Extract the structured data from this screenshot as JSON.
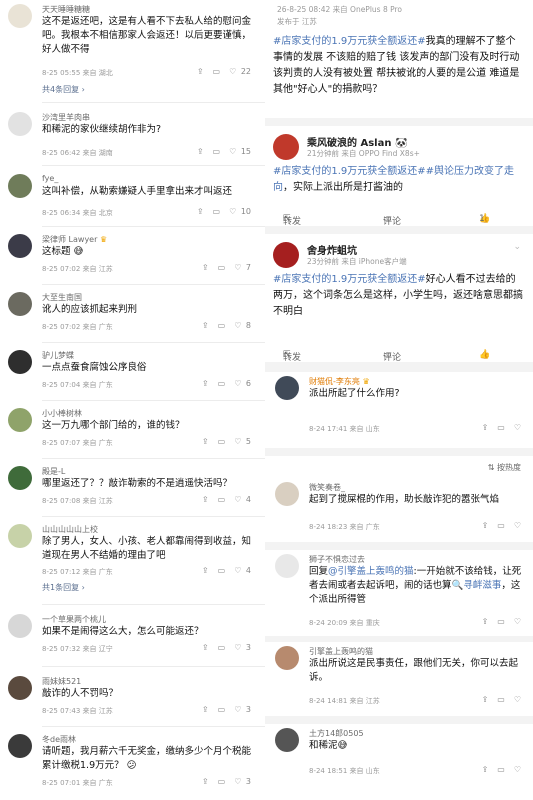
{
  "left": [
    {
      "name": "天天睡睡糖糖",
      "text": "这不是返还吧，这是有人看不下去私人给的慰问金吧。我根本不相信那家人会返还！以后更要谨慎，好人做不得",
      "meta": "8-25 05:55 来自 湖北",
      "likes": "22",
      "replies": "共4条回复"
    },
    {
      "name": "沙湾里羊肉串",
      "text": "和稀泥的家伙继续胡作非为?",
      "meta": "8-25 06:42 来自 湖南",
      "likes": "15"
    },
    {
      "name": "fye_",
      "text": "这叫补偿，从勒索嫌疑人手里拿出来才叫返还",
      "meta": "8-25 06:34 来自 北京",
      "likes": "10"
    },
    {
      "name": "梁律师 Lawyer",
      "text": "这标题",
      "meta": "8-25 07:02 来自 江苏",
      "likes": "7"
    },
    {
      "name": "大至生南国",
      "text": "讹人的应该抓起来判刑",
      "meta": "8-25 07:02 来自 广东",
      "likes": "8"
    },
    {
      "name": "驴儿梦蝶",
      "text": "一点点蚕食腐蚀公序良俗",
      "meta": "8-25 07:04 来自 广东",
      "likes": "6"
    },
    {
      "name": "小小棒树林",
      "text": "这一万九哪个部门给的，谁的钱？",
      "meta": "8-25 07:07 来自 广东",
      "likes": "5"
    },
    {
      "name": "殿是-L",
      "text": "哪里返还了？？敲诈勒索的不是逍遥快活吗？",
      "meta": "8-25 07:08 来自 江苏",
      "likes": "4"
    },
    {
      "name": "山山山山山上校",
      "text": "除了男人，女人、小孩、老人都靠闹得到收益，知道现在男人不结婚的理由了吧",
      "meta": "8-25 07:12 来自 广东",
      "likes": "4",
      "replies": "共1条回复"
    },
    {
      "name": "一个草果两个桃儿",
      "text": "如果不是闹得这么大，怎么可能返还？",
      "meta": "8-25 07:32 来自 辽宁",
      "likes": "3"
    },
    {
      "name": "雨妹妹521",
      "text": "敲诈的人不罚吗？",
      "meta": "8-25 07:43 来自 江苏",
      "likes": "3"
    },
    {
      "name": "冬de雨林",
      "text": "请听题，我月薪六千无奖金，缴纳多少个月个税能累计缴税1.9万元？",
      "meta": "8-25 07:01 来自 广东",
      "likes": "3"
    }
  ],
  "right": {
    "top_meta1": "26-8-25 08:42  来自 OnePlus 8 Pro",
    "top_meta2": "发布于 江苏",
    "post1_text_tag": "#店家支付的1.9万元获全额返还#",
    "post1_text": "我真的理解不了整个事情的发展 不该赔的赔了钱 该发声的部门没有及时行动 该判责的人没有被处置 帮扶被讹的人要的是公道 难道是其他\"好心人\"的捐款吗？",
    "post2_name": "乘风破浪的 Aslan",
    "post2_meta": "21分钟前  来自 OPPO Find X8s+",
    "post2_tag1": "#店家支付的1.9万元获全额返还#",
    "post2_tag2": "#舆论压力改变了走向",
    "post2_text": "，实际上派出所是打酱油的",
    "repost": "转发",
    "comment": "评论",
    "like_count": "1",
    "post3_name": "舍身炸蛆坑",
    "post3_meta": "23分钟前  来自 iPhone客户端",
    "post3_tag": "#店家支付的1.9万元获全额返还#",
    "post3_text": "好心人看不过去给的两万，这个词条怎么是这样，小学生吗，返还啥意思都搞不明白",
    "post3_likes": "",
    "c1_name": "财猫侃-李东亮",
    "c1_text": "派出所起了什么作用?",
    "c1_meta": "8-24 17:41 来自 山东",
    "sort_label": "按热度",
    "c2_name": "微笑奏卷_",
    "c2_text": "起到了搅屎棍的作用，助长敲诈犯的嚣张气焰",
    "c2_meta": "8-24 18:23 来自 广东",
    "c3_name": "狮子不惧恋过去",
    "c3_text_a": "回复",
    "c3_mention": "@引擎盖上轰鸣的猫",
    "c3_text_b": ":一开始就不该给钱，让死者去闹或者去起诉吧，闹的话也算",
    "c3_tag": "寻衅滋事",
    "c3_text_c": "，这个派出所得管",
    "c3_meta": "8-24 20:09 来自 重庆",
    "c4_name": "引擎盖上轰鸣的猫",
    "c4_text": "派出所说这是民事责任，跟他们无关，你可以去起诉。",
    "c4_meta": "8-24 14:81 来自 江苏",
    "c5_name": "土方14郎0505",
    "c5_text": "和稀泥",
    "c5_meta": "8-24 18:51 来自 山东"
  }
}
